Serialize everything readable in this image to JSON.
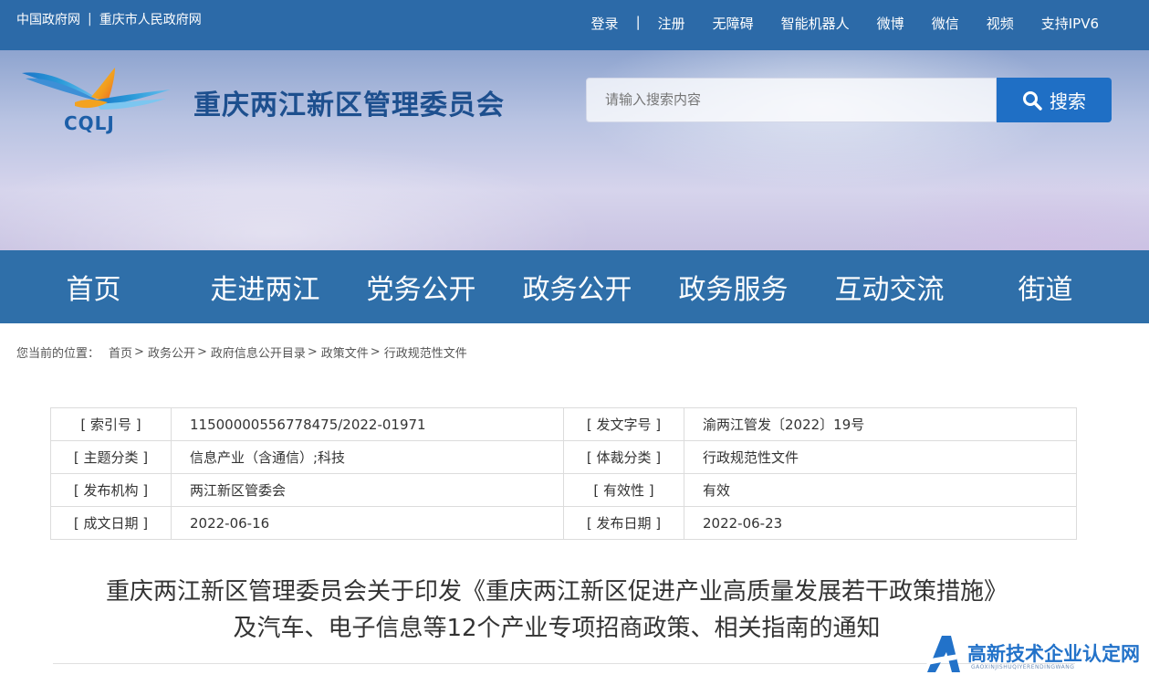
{
  "topbar": {
    "links_left": [
      "中国政府网",
      "重庆市人民政府网"
    ],
    "links_right": [
      "登录",
      "注册",
      "无障碍",
      "智能机器人",
      "微博",
      "微信",
      "视频",
      "支持IPV6"
    ]
  },
  "header": {
    "logo_text": "CQLJ",
    "site_title": "重庆两江新区管理委员会",
    "search_placeholder": "请输入搜索内容",
    "search_button": "搜索"
  },
  "nav": [
    "首页",
    "走进两江",
    "党务公开",
    "政务公开",
    "政务服务",
    "互动交流",
    "街道"
  ],
  "breadcrumb": {
    "prefix": "您当前的位置：",
    "items": [
      "首页",
      "政务公开",
      "政府信息公开目录",
      "政策文件",
      "行政规范性文件"
    ]
  },
  "meta": [
    {
      "k1": "[ 索引号 ]",
      "v1": "11500000556778475/2022-01971",
      "k2": "[ 发文字号 ]",
      "v2": "渝两江管发〔2022〕19号"
    },
    {
      "k1": "[ 主题分类 ]",
      "v1": "信息产业（含通信）;科技",
      "k2": "[ 体裁分类 ]",
      "v2": "行政规范性文件"
    },
    {
      "k1": "[ 发布机构 ]",
      "v1": "两江新区管委会",
      "k2": "[ 有效性 ]",
      "v2": "有效"
    },
    {
      "k1": "[ 成文日期 ]",
      "v1": "2022-06-16",
      "k2": "[ 发布日期 ]",
      "v2": "2022-06-23"
    }
  ],
  "doc_title": {
    "line1": "重庆两江新区管理委员会关于印发《重庆两江新区促进产业高质量发展若干政策措施》",
    "line2": "及汽车、电子信息等12个产业专项招商政策、相关指南的通知"
  },
  "watermark": {
    "text": "高新技术企业认定网",
    "sub": "GAOXINJISHUQIYERENDINGWANG"
  },
  "colors": {
    "topbar": "#2c6aa8",
    "nav": "#2f6fa9",
    "title": "#1d4f8e",
    "search_button": "#1f6fc5"
  }
}
